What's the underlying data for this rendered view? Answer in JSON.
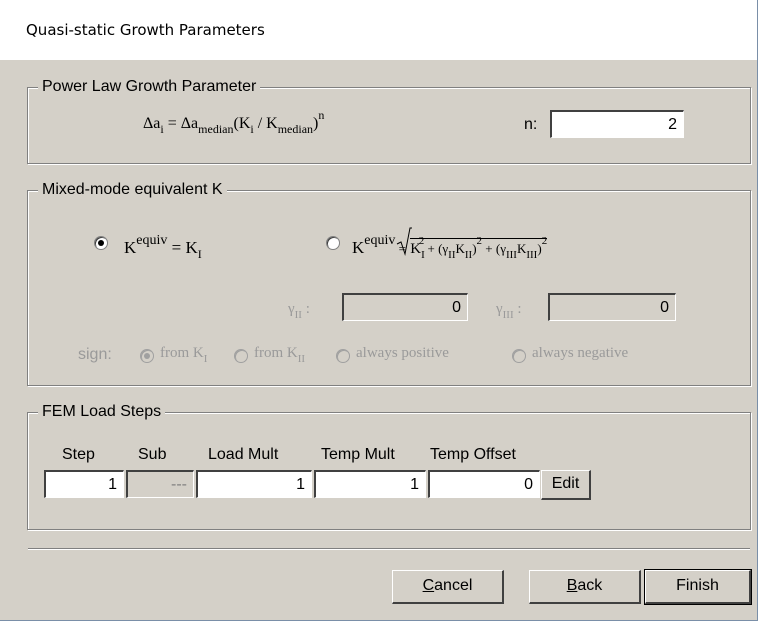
{
  "window": {
    "title": "Quasi-static Growth Parameters"
  },
  "power_law": {
    "legend": "Power Law Growth Parameter",
    "formula": {
      "delta": "Δa",
      "i": "i",
      "eq": " = Δa",
      "median": "median",
      "mid": "(K",
      "div": " / K",
      "close": ")",
      "exp": "n"
    },
    "n_label": "n:",
    "n_value": "2"
  },
  "mixed_mode": {
    "legend": "Mixed-mode equivalent K",
    "option1": {
      "k": "K",
      "equiv": "equiv",
      "rhs": " = K",
      "sub": "I"
    },
    "option2": {
      "k": "K",
      "equiv": "equiv",
      "eq": " =",
      "t1": "K",
      "t1sub": "I",
      "t1sup": "2",
      "plus1": " + (γ",
      "g2sub": "II",
      "k2": "K",
      "k2sub": "II",
      "close2": ")",
      "sq2": "2",
      "plus2": " + (γ",
      "g3sub": "III",
      "k3": "K",
      "k3sub": "III",
      "close3": ")",
      "sq3": "2"
    },
    "gamma2_label": "γ",
    "gamma2_sub": "II",
    "gamma2_colon": " :",
    "gamma2_value": "0",
    "gamma3_label": "γ",
    "gamma3_sub": "III",
    "gamma3_colon": " :",
    "gamma3_value": "0",
    "sign_label": "sign:",
    "sign_options": [
      {
        "label": "from K",
        "sub": "I",
        "checked": true
      },
      {
        "label": "from K",
        "sub": "II",
        "checked": false
      },
      {
        "label": "always positive",
        "sub": "",
        "checked": false
      },
      {
        "label": "always negative",
        "sub": "",
        "checked": false
      }
    ]
  },
  "fem": {
    "legend": "FEM Load Steps",
    "headers": {
      "step": "Step",
      "sub": "Sub",
      "load": "Load Mult",
      "temp": "Temp Mult",
      "offset": "Temp Offset"
    },
    "row": {
      "step": "1",
      "sub": "---",
      "load": "1",
      "temp": "1",
      "offset": "0"
    },
    "edit_label": "Edit"
  },
  "buttons": {
    "cancel_prefix": "",
    "cancel_u": "C",
    "cancel_rest": "ancel",
    "back_u": "B",
    "back_rest": "ack",
    "finish": "Finish"
  }
}
